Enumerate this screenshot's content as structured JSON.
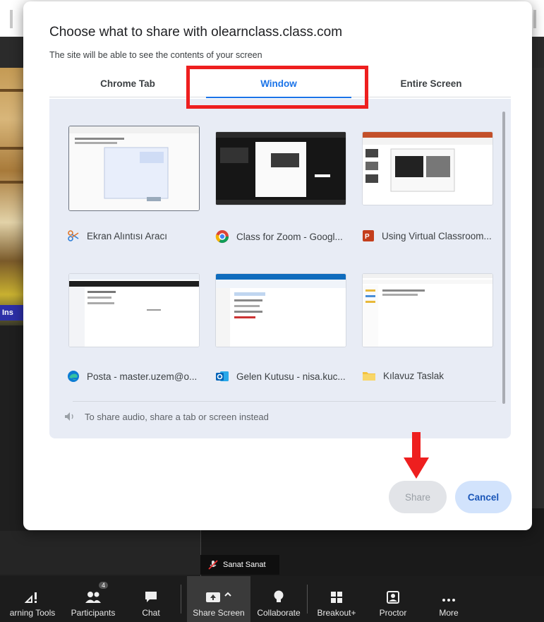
{
  "dialog": {
    "title": "Choose what to share with olearnclass.class.com",
    "subtitle": "The site will be able to see the contents of your screen",
    "tabs": [
      {
        "label": "Chrome Tab",
        "active": false
      },
      {
        "label": "Window",
        "active": true
      },
      {
        "label": "Entire Screen",
        "active": false
      }
    ],
    "windows": [
      {
        "label": "Ekran Alıntısı Aracı",
        "icon": "snipping-tool-icon"
      },
      {
        "label": "Class for Zoom - Googl...",
        "icon": "chrome-icon"
      },
      {
        "label": "Using Virtual Classroom...",
        "icon": "powerpoint-icon"
      },
      {
        "label": "Posta - master.uzem@o...",
        "icon": "edge-icon"
      },
      {
        "label": "Gelen Kutusu - nisa.kuc...",
        "icon": "outlook-icon"
      },
      {
        "label": "Kılavuz Taslak",
        "icon": "folder-icon"
      }
    ],
    "audio_note": "To share audio, share a tab or screen instead",
    "share_label": "Share",
    "cancel_label": "Cancel"
  },
  "background": {
    "left_badge": "Ins",
    "participant_name": "Sanat Sanat"
  },
  "toolbar": {
    "items": [
      {
        "label": "arning Tools",
        "icon": "learning-tools-icon"
      },
      {
        "label": "Participants",
        "icon": "participants-icon",
        "count": "4"
      },
      {
        "label": "Chat",
        "icon": "chat-icon"
      },
      {
        "label": "Share Screen",
        "icon": "share-screen-icon"
      },
      {
        "label": "Collaborate",
        "icon": "lightbulb-icon"
      },
      {
        "label": "Breakout+",
        "icon": "grid-icon"
      },
      {
        "label": "Proctor",
        "icon": "proctor-icon"
      },
      {
        "label": "More",
        "icon": "more-icon"
      }
    ]
  },
  "colors": {
    "accent": "#1a73e8",
    "annotation_red": "#ee1f1f",
    "panel_bg": "#e8ecf5"
  }
}
